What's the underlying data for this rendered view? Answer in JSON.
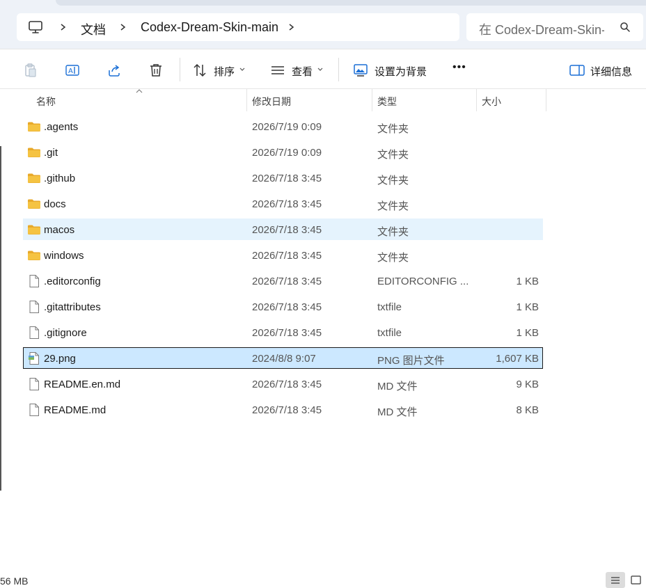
{
  "address": {
    "segments": [
      "文档",
      "Codex-Dream-Skin-main"
    ],
    "icons": [
      "computer-icon",
      "chevron-right-icon"
    ]
  },
  "search": {
    "placeholder": "在 Codex-Dream-Skin-main 中搜索"
  },
  "toolbar": {
    "sort_label": "排序",
    "view_label": "查看",
    "set_background_label": "设置为背景",
    "more_label": "•••",
    "details_label": "详细信息",
    "icons": [
      "paste-icon",
      "rename-icon",
      "share-icon",
      "delete-icon",
      "sort-icon",
      "view-icon",
      "wallpaper-icon",
      "details-pane-icon"
    ]
  },
  "columns": {
    "name": "名称",
    "date": "修改日期",
    "type": "类型",
    "size": "大小"
  },
  "files": [
    {
      "name": ".agents",
      "date": "2026/7/19 0:09",
      "type": "文件夹",
      "size": "",
      "kind": "folder",
      "state": ""
    },
    {
      "name": ".git",
      "date": "2026/7/19 0:09",
      "type": "文件夹",
      "size": "",
      "kind": "folder",
      "state": ""
    },
    {
      "name": ".github",
      "date": "2026/7/18 3:45",
      "type": "文件夹",
      "size": "",
      "kind": "folder",
      "state": ""
    },
    {
      "name": "docs",
      "date": "2026/7/18 3:45",
      "type": "文件夹",
      "size": "",
      "kind": "folder",
      "state": ""
    },
    {
      "name": "macos",
      "date": "2026/7/18 3:45",
      "type": "文件夹",
      "size": "",
      "kind": "folder",
      "state": "hover"
    },
    {
      "name": "windows",
      "date": "2026/7/18 3:45",
      "type": "文件夹",
      "size": "",
      "kind": "folder",
      "state": ""
    },
    {
      "name": ".editorconfig",
      "date": "2026/7/18 3:45",
      "type": "EDITORCONFIG ...",
      "size": "1 KB",
      "kind": "file",
      "state": ""
    },
    {
      "name": ".gitattributes",
      "date": "2026/7/18 3:45",
      "type": "txtfile",
      "size": "1 KB",
      "kind": "file",
      "state": ""
    },
    {
      "name": ".gitignore",
      "date": "2026/7/18 3:45",
      "type": "txtfile",
      "size": "1 KB",
      "kind": "file",
      "state": ""
    },
    {
      "name": "29.png",
      "date": "2024/8/8 9:07",
      "type": "PNG 图片文件",
      "size": "1,607 KB",
      "kind": "image",
      "state": "selected"
    },
    {
      "name": "README.en.md",
      "date": "2026/7/18 3:45",
      "type": "MD 文件",
      "size": "9 KB",
      "kind": "file",
      "state": ""
    },
    {
      "name": "README.md",
      "date": "2026/7/18 3:45",
      "type": "MD 文件",
      "size": "8 KB",
      "kind": "file",
      "state": ""
    }
  ],
  "status": {
    "text": "56 MB"
  },
  "colors": {
    "folder": "#f5c342",
    "selected_bg": "#cce8ff",
    "hover_bg": "#e5f3fd",
    "accent": "#1a6fd6"
  }
}
